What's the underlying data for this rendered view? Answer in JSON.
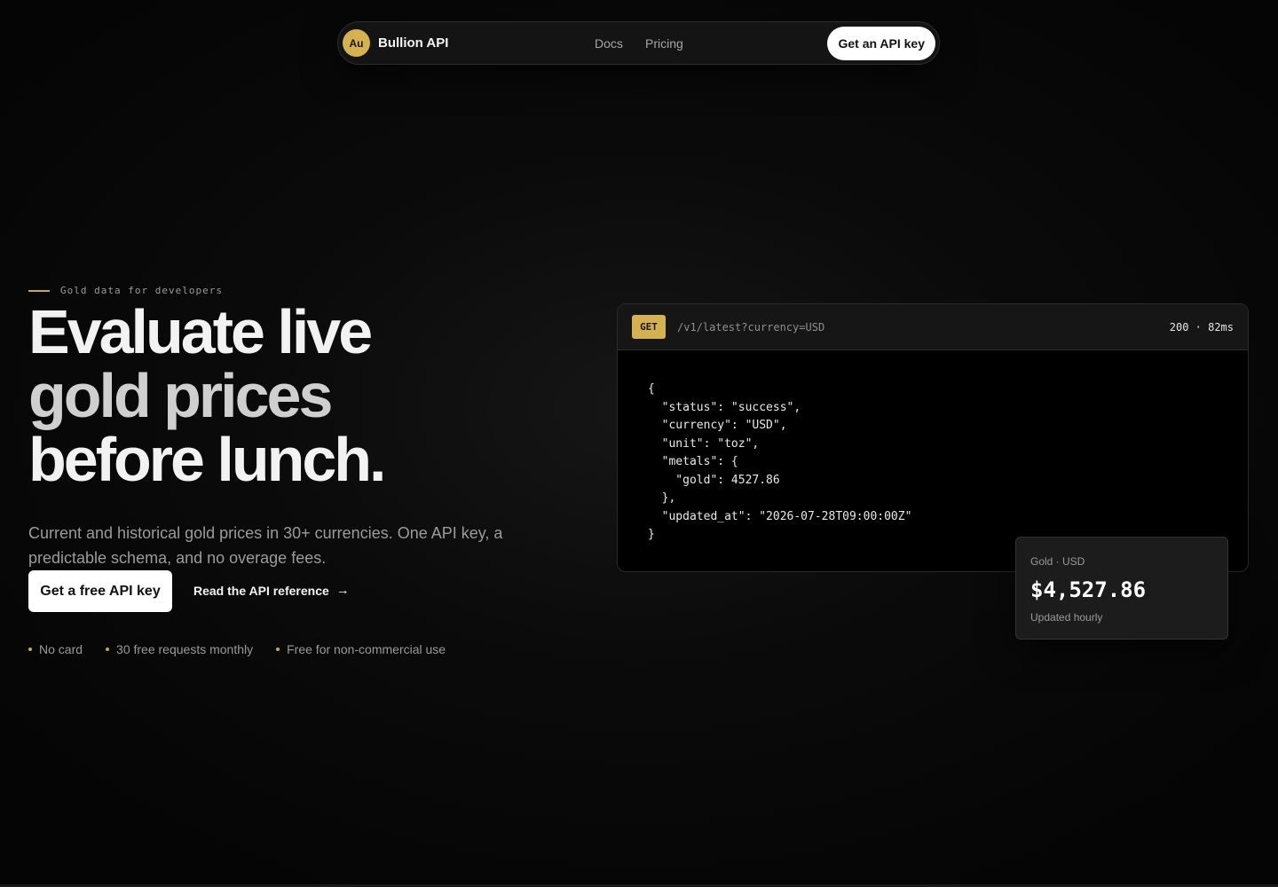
{
  "nav": {
    "logo_text": "Au",
    "brand": "Bullion API",
    "links": [
      "Docs",
      "Pricing"
    ],
    "cta": "Get an API key"
  },
  "hero": {
    "eyebrow": "Gold data for developers",
    "headline": [
      "Evaluate live",
      "gold prices",
      "before lunch."
    ],
    "subhead": "Current and historical gold prices in 30+ currencies. One API key, a predictable schema, and no overage fees.",
    "primary_cta": "Get a free API key",
    "secondary_cta": "Read the API reference",
    "secondary_cta_icon": "→",
    "features": [
      "No card",
      "30 free requests monthly",
      "Free for non-commercial use"
    ]
  },
  "request": {
    "method": "GET",
    "endpoint": "/v1/latest?currency=USD",
    "status": "200 · 82ms",
    "response": "{\n  \"status\": \"success\",\n  \"currency\": \"USD\",\n  \"unit\": \"toz\",\n  \"metals\": {\n    \"gold\": 4527.86\n  },\n  \"updated_at\": \"2026-07-28T09:00:00Z\"\n}"
  },
  "price_card": {
    "label": "Gold · USD",
    "value": "$4,527.86",
    "note": "Updated hourly"
  },
  "colors": {
    "accent_gold": "#d4b252",
    "background": "#050505"
  }
}
